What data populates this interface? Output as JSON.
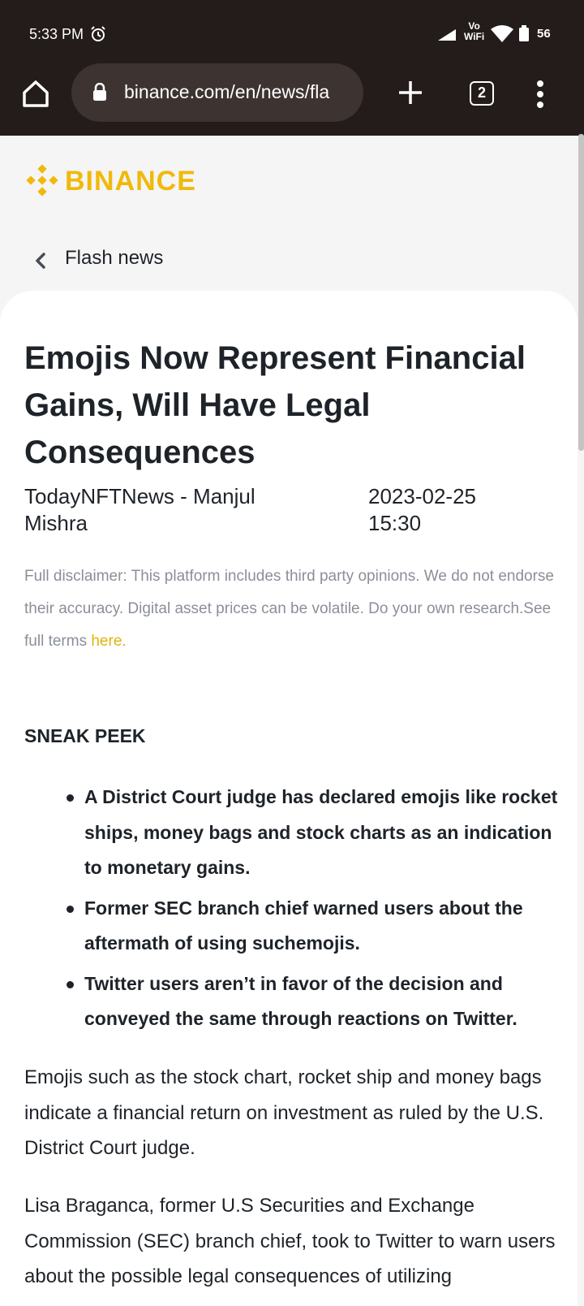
{
  "status_bar": {
    "time": "5:33 PM",
    "network": "Vo\nWiFi",
    "battery": "56"
  },
  "browser": {
    "url": "binance.com/en/news/fla",
    "tab_count": "2"
  },
  "site": {
    "logo_text": "BINANCE",
    "brand_color": "#f0b90b",
    "back_label": "Flash news"
  },
  "article": {
    "title": "Emojis Now Represent Financial Gains, Will Have Legal Consequences",
    "author": "TodayNFTNews - Manjul Mishra",
    "date": "2023-02-25 15:30",
    "disclaimer": "Full disclaimer: This platform includes third party opinions. We do not endorse their accuracy. Digital asset prices can be volatile. Do your own research.See full terms ",
    "terms_link": "here.",
    "section_heading": "SNEAK PEEK",
    "bullets": [
      "A District Court judge has declared emojis like rocket ships, money bags and stock charts as an indication to monetary gains.",
      "Former SEC branch chief warned users about the aftermath of using suchemojis.",
      "Twitter users aren’t in favor of the decision and conveyed the same through reactions on Twitter."
    ],
    "paragraphs": [
      "Emojis such as the stock chart, rocket ship and money bags indicate a financial return on investment as ruled by the U.S. District Court judge.",
      "Lisa Braganca, former U.S Securities and Exchange Commission (SEC) branch chief, took to Twitter to warn users about the possible legal consequences of utilizing"
    ]
  }
}
